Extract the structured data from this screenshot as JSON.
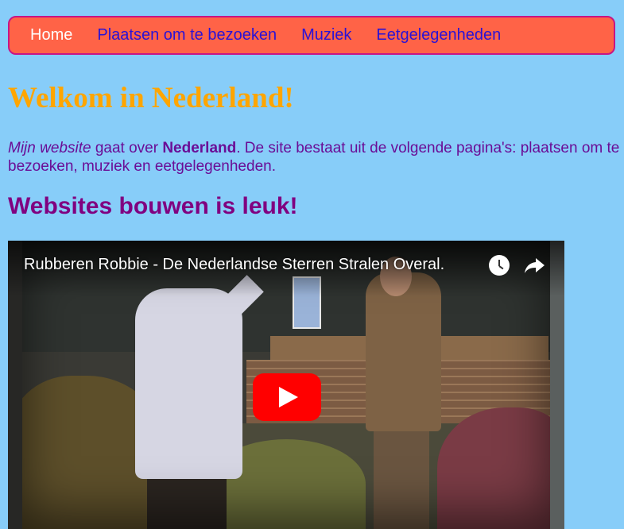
{
  "nav": {
    "items": [
      {
        "label": "Home"
      },
      {
        "label": "Plaatsen om te bezoeken"
      },
      {
        "label": "Muziek"
      },
      {
        "label": "Eetgelegenheden"
      }
    ]
  },
  "heading": "Welkom in Nederland!",
  "intro": {
    "em": "Mijn website",
    "text1": " gaat over ",
    "strong": "Nederland",
    "text2": ". De site bestaat uit de volgende pagina's: plaatsen om te bezoeken, muziek en eetgelegenheden."
  },
  "subheading": "Websites bouwen is leuk!",
  "video": {
    "title": "Rubberen Robbie - De Nederlandse Sterren Stralen Overal.",
    "watch_later_icon": "clock-icon",
    "share_icon": "share-icon",
    "play_icon": "youtube-play-icon"
  },
  "colors": {
    "background": "#87cdf9",
    "nav_background": "#ff6347",
    "nav_border": "#c71585",
    "heading": "#ffa500",
    "subheading": "#800080",
    "play_button": "#ff0000"
  }
}
